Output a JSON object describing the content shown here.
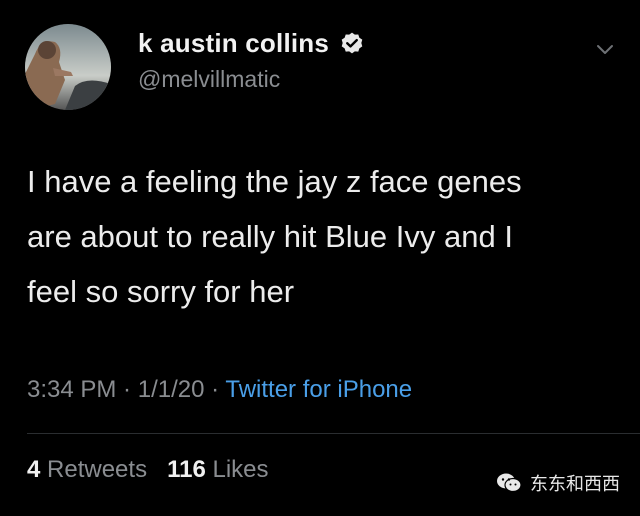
{
  "author": {
    "display_name": "k austin collins",
    "handle": "@melvillmatic",
    "verified": true
  },
  "tweet": {
    "lines": [
      "I have a feeling the jay z face genes",
      "are about to really hit Blue Ivy and I",
      "feel so sorry for her"
    ]
  },
  "meta": {
    "time": "3:34 PM",
    "sep1": " · ",
    "date": "1/1/20",
    "sep2": " · ",
    "source": "Twitter for iPhone"
  },
  "stats": {
    "retweets_count": "4",
    "retweets_label": "Retweets",
    "likes_count": "116",
    "likes_label": "Likes"
  },
  "watermark": {
    "text": "东东和西西"
  },
  "colors": {
    "background": "#000000",
    "link": "#4a9fe8",
    "secondary_text": "#8a8d91"
  }
}
